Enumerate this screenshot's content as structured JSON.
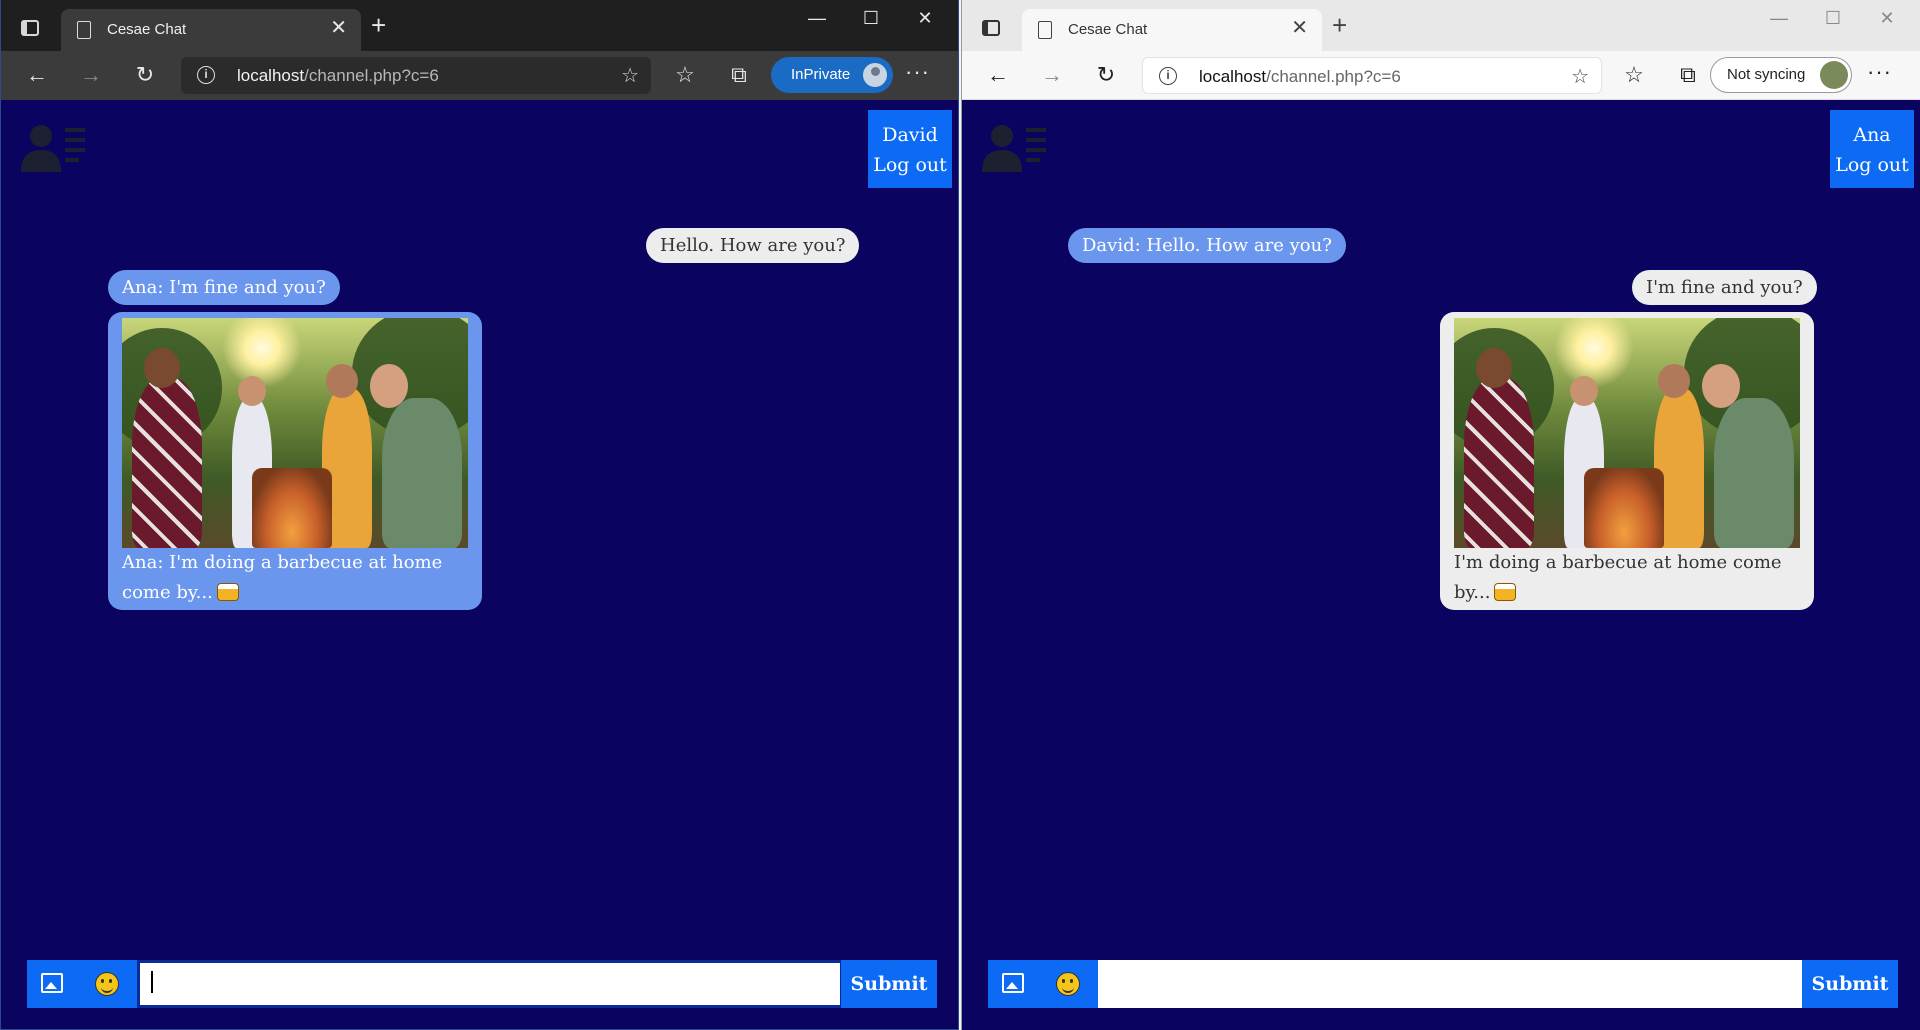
{
  "windows": {
    "left": {
      "tab_title": "Cesae Chat",
      "url_host": "localhost",
      "url_path": "/channel.php?c=6",
      "profile_label": "InPrivate",
      "user_name": "David",
      "logout_label": "Log out",
      "messages": {
        "self_1": "Hello. How are you?",
        "other_1": "Ana: I'm fine and you?",
        "image_caption": "Ana: I'm doing a barbecue at home come by..."
      },
      "submit_label": "Submit",
      "input_value": ""
    },
    "right": {
      "tab_title": "Cesae Chat",
      "url_host": "localhost",
      "url_path": "/channel.php?c=6",
      "profile_label": "Not syncing",
      "user_name": "Ana",
      "logout_label": "Log out",
      "messages": {
        "other_1": "David: Hello. How are you?",
        "self_1": "I'm fine and you?",
        "image_caption": "I'm doing a barbecue at home come by..."
      },
      "submit_label": "Submit",
      "input_value": ""
    }
  },
  "icons": {
    "emoji_in_caption": "beer-mugs-emoji",
    "input_left": "image-upload-icon",
    "input_right": "smiley-emoji-icon"
  },
  "colors": {
    "page_bg": "#0a0460",
    "accent_blue": "#0c6af4",
    "other_bubble": "#6b96ee",
    "self_bubble": "#ededed"
  }
}
